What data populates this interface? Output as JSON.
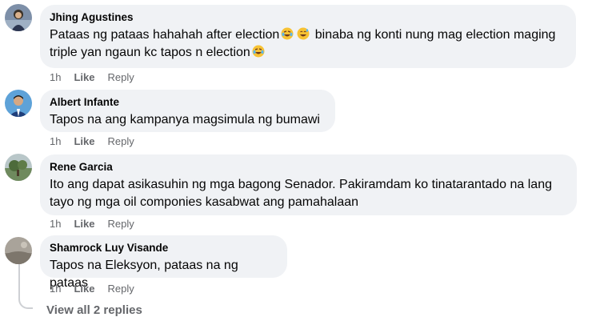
{
  "comments": [
    {
      "author": "Jhing Agustines",
      "text_parts": [
        "Pataas ng pataas hahahah after election",
        "binaba ng konti nung mag election maging triple yan ngaun kc tapos n election"
      ],
      "emoji": [
        "rolling-on-floor-laughing-emoji",
        "grinning-sweat-emoji",
        "rolling-on-floor-laughing-emoji"
      ],
      "time": "1h",
      "like": "Like",
      "reply": "Reply"
    },
    {
      "author": "Albert Infante",
      "text": "Tapos na ang kampanya magsimula ng bumawi",
      "time": "1h",
      "like": "Like",
      "reply": "Reply"
    },
    {
      "author": "Rene Garcia",
      "text": "Ito ang dapat asikasuhin ng mga bagong Senador. Pakiramdam ko tinatarantado na lang tayo ng mga oil componies kasabwat ang pamahalaan",
      "time": "1h",
      "like": "Like",
      "reply": "Reply"
    },
    {
      "author": "Shamrock Luy Visande",
      "text": "Tapos na Eleksyon, pataas na ng pataas",
      "time": "1h",
      "like": "Like",
      "reply": "Reply"
    }
  ],
  "view_replies": "View all 2 replies",
  "colors": {
    "bubble": "#f0f2f5",
    "meta_text": "#65676b",
    "text": "#050505"
  }
}
